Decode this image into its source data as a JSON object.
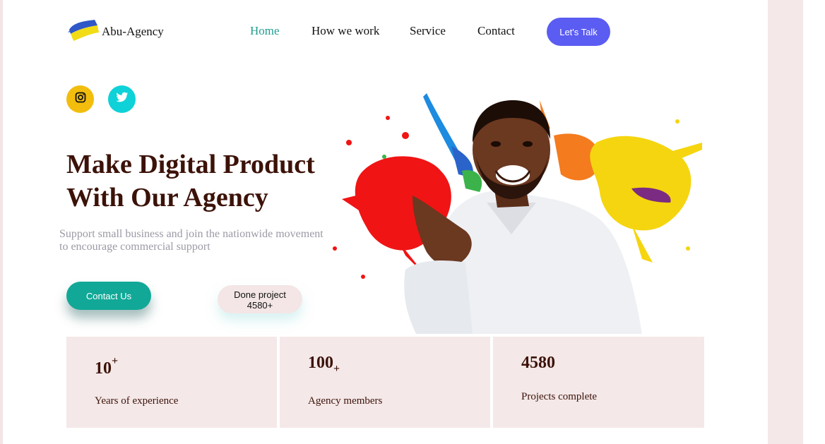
{
  "header": {
    "brand": "Abu-Agency",
    "nav": [
      {
        "label": "Home",
        "active": true
      },
      {
        "label": "How we work",
        "active": false
      },
      {
        "label": "Service",
        "active": false
      },
      {
        "label": "Contact",
        "active": false
      }
    ],
    "cta_label": "Let's Talk"
  },
  "social": {
    "icons": [
      "instagram-icon",
      "twitter-icon"
    ]
  },
  "hero": {
    "title_line1": "Make Digital Product",
    "title_line2": "With Our Agency",
    "subtitle": "Support small business and join the nationwide movement to encourage commercial support",
    "contact_label": "Contact Us",
    "done_line1": "Done project",
    "done_line2": "4580+"
  },
  "stats": [
    {
      "value": "10",
      "suffix": "+",
      "label": "Years of experience"
    },
    {
      "value": "100",
      "suffix": "+",
      "label": "Agency members"
    },
    {
      "value": "4580",
      "suffix": "",
      "label": "Projects complete"
    }
  ],
  "colors": {
    "accent_teal": "#12a897",
    "accent_purple": "#5a5cf2",
    "heading": "#3c1208",
    "panel_pink": "#f4e8e8",
    "instagram_yellow": "#f3bd0e",
    "twitter_cyan": "#0fd1d8"
  }
}
